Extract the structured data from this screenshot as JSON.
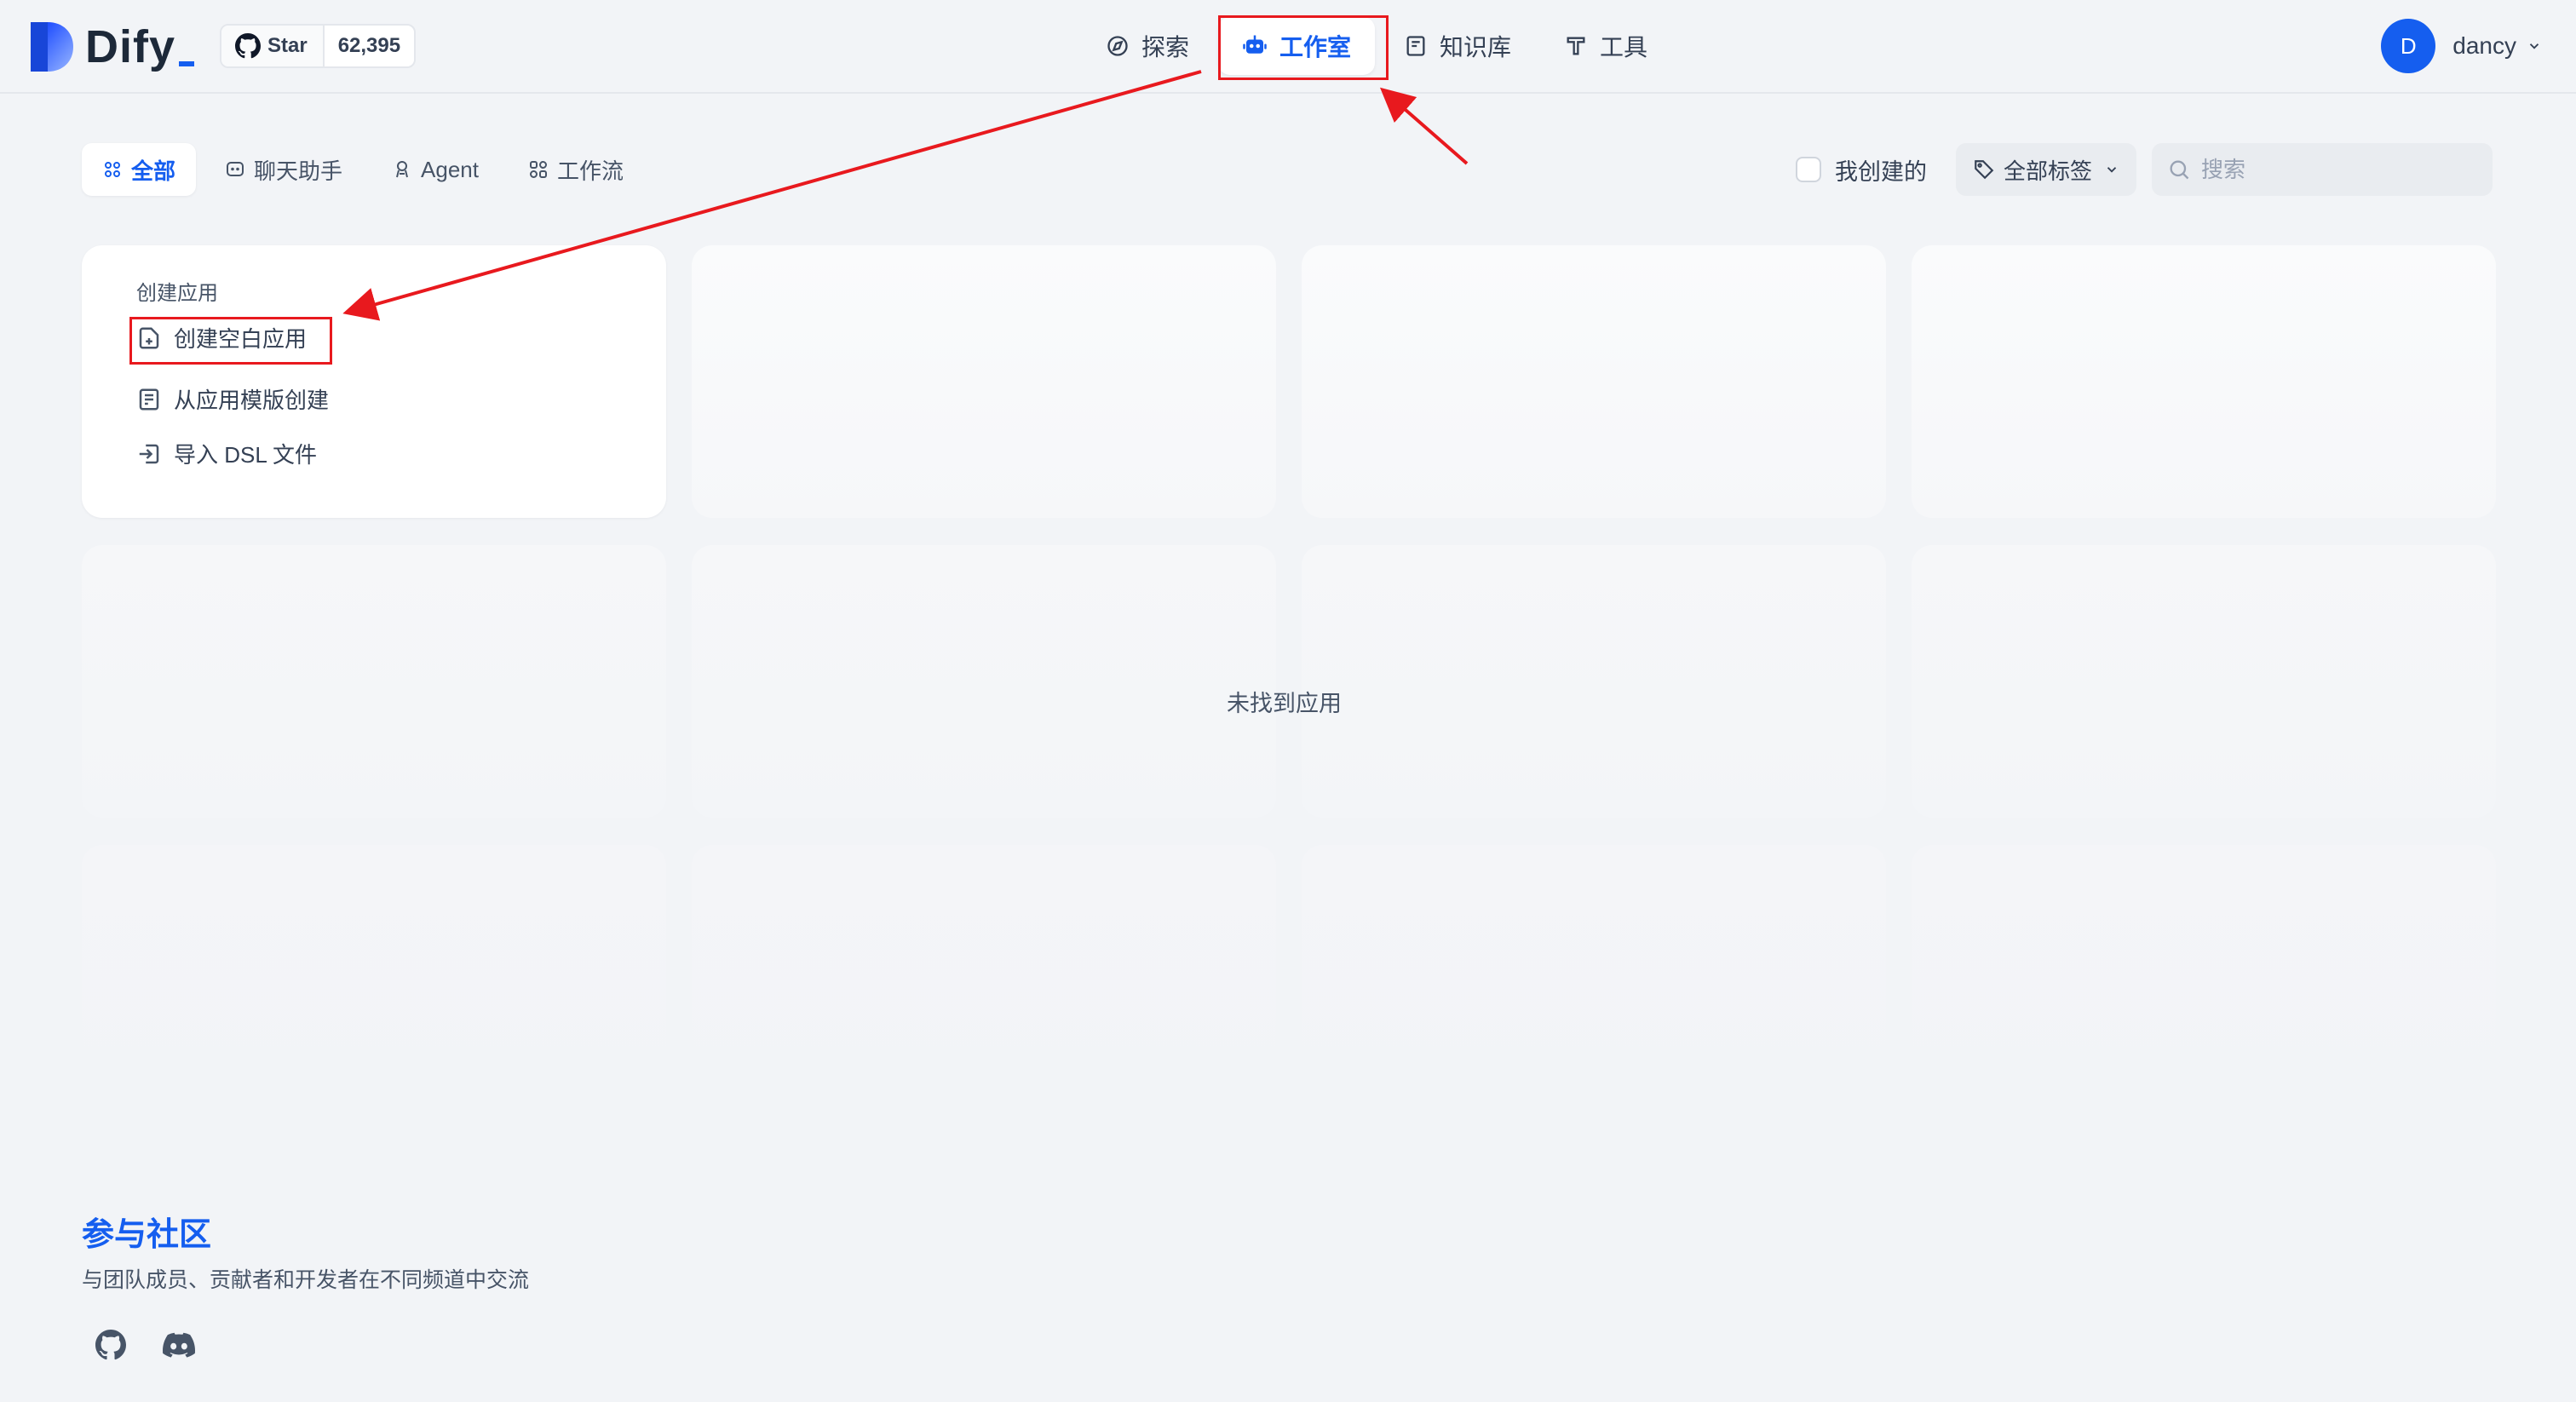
{
  "header": {
    "logo_text": "Dify",
    "github": {
      "star_label": "Star",
      "star_count": "62,395"
    },
    "nav": [
      {
        "label": "探索",
        "icon": "compass-icon"
      },
      {
        "label": "工作室",
        "icon": "robot-icon"
      },
      {
        "label": "知识库",
        "icon": "book-icon"
      },
      {
        "label": "工具",
        "icon": "hammer-icon"
      }
    ],
    "user": {
      "initial": "D",
      "name": "dancy"
    }
  },
  "tabs": [
    {
      "label": "全部",
      "icon": "grid-icon"
    },
    {
      "label": "聊天助手",
      "icon": "chat-icon"
    },
    {
      "label": "Agent",
      "icon": "agent-icon"
    },
    {
      "label": "工作流",
      "icon": "workflow-icon"
    }
  ],
  "filters": {
    "created_by_me_label": "我创建的",
    "tags_label": "全部标签",
    "search_placeholder": "搜索"
  },
  "create_card": {
    "title": "创建应用",
    "items": [
      {
        "label": "创建空白应用",
        "icon": "file-plus-icon"
      },
      {
        "label": "从应用模版创建",
        "icon": "template-icon"
      },
      {
        "label": "导入 DSL 文件",
        "icon": "import-icon"
      }
    ]
  },
  "empty_state": "未找到应用",
  "community": {
    "title": "参与社区",
    "subtitle": "与团队成员、贡献者和开发者在不同频道中交流",
    "icons": [
      "github-icon",
      "discord-icon"
    ]
  },
  "colors": {
    "accent": "#155eef",
    "background": "#f2f4f7",
    "annotation_red": "#e8191e"
  }
}
